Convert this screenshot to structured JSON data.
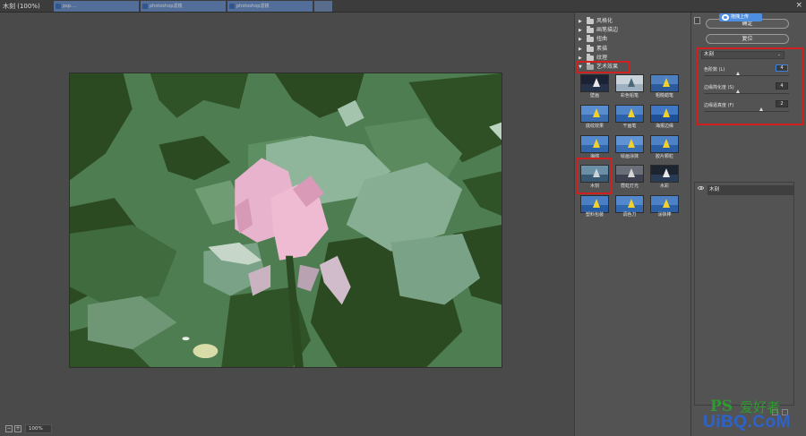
{
  "window": {
    "title": "木刻 (100%)",
    "close_glyph": "×"
  },
  "background_tabs": [
    {
      "label": "psp...."
    },
    {
      "label": "photoshop滤镜"
    },
    {
      "label": "photoshop滤镜"
    }
  ],
  "status": {
    "zoom": "100%",
    "zoom_out": "−",
    "zoom_in": "+"
  },
  "filter_gallery": {
    "categories": [
      {
        "label": "风格化",
        "expanded": false
      },
      {
        "label": "画笔描边",
        "expanded": false
      },
      {
        "label": "扭曲",
        "expanded": false
      },
      {
        "label": "素描",
        "expanded": false
      },
      {
        "label": "纹理",
        "expanded": false
      },
      {
        "label": "艺术效果",
        "expanded": true
      }
    ],
    "thumbnails": [
      {
        "label": "壁画",
        "selected": false
      },
      {
        "label": "彩色铅笔",
        "selected": false
      },
      {
        "label": "粗糙蜡笔",
        "selected": false
      },
      {
        "label": "底纹效果",
        "selected": false
      },
      {
        "label": "干画笔",
        "selected": false
      },
      {
        "label": "海报边缘",
        "selected": false
      },
      {
        "label": "海绵",
        "selected": false
      },
      {
        "label": "绘画涂抹",
        "selected": false
      },
      {
        "label": "胶片颗粒",
        "selected": false
      },
      {
        "label": "木刻",
        "selected": true
      },
      {
        "label": "霓虹灯光",
        "selected": false
      },
      {
        "label": "水彩",
        "selected": false
      },
      {
        "label": "塑料包装",
        "selected": false
      },
      {
        "label": "调色刀",
        "selected": false
      },
      {
        "label": "涂抹棒",
        "selected": false
      }
    ]
  },
  "settings": {
    "ok_label": "确定",
    "reset_label": "复位",
    "upload_badge": "拖拽上传",
    "selected_filter": "木刻",
    "params": [
      {
        "label": "色阶数 (L)",
        "value": "4",
        "fraction": 0.4
      },
      {
        "label": "边缘简化度 (S)",
        "value": "4",
        "fraction": 0.4
      },
      {
        "label": "边缘逼真度 (F)",
        "value": "2",
        "fraction": 0.67
      }
    ]
  },
  "effect_layers": [
    {
      "label": "木刻"
    }
  ],
  "watermark": {
    "ps": "PS",
    "cn": "爱好者",
    "url": "UiBQ.CoM"
  },
  "colors": {
    "highlight_red": "#d02020",
    "dark_green": "#2c4a22",
    "mid_green": "#4b7a4f",
    "light_green": "#8fb59a",
    "lotus_pink": "#e8b3cc"
  }
}
